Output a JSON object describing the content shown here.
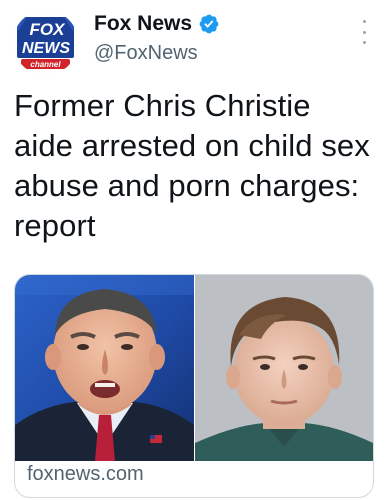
{
  "tweet": {
    "author": {
      "display_name": "Fox News",
      "handle": "@FoxNews",
      "verified": true,
      "avatar_logo": {
        "line1": "FOX",
        "line2": "NEWS",
        "line3": "channel",
        "colors": {
          "blue": "#1b3f94",
          "red": "#d2232a",
          "white": "#ffffff"
        }
      }
    },
    "text": "Former Chris Christie aide arrested on child sex abuse and porn charges: report",
    "card": {
      "domain": "foxnews.com",
      "image_icons": [
        "portrait-photo-left",
        "mugshot-photo-right"
      ]
    }
  },
  "colors": {
    "text_primary": "#0f1419",
    "text_secondary": "#536471",
    "verified_blue": "#1d9bf0",
    "card_border": "#cfd9de"
  }
}
